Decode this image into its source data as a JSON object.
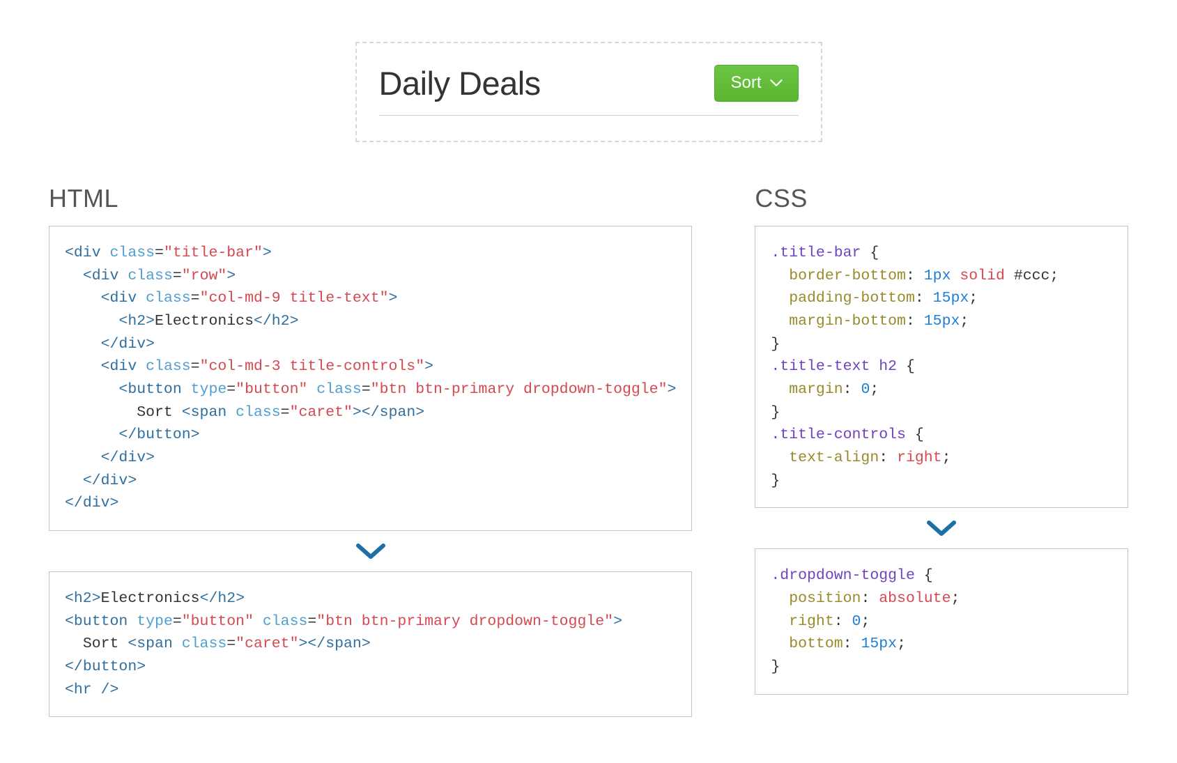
{
  "preview": {
    "title": "Daily Deals",
    "sort_button_label": "Sort"
  },
  "left": {
    "heading": "HTML",
    "code_top_html": "<span class=\"c-punc\">&lt;</span><span class=\"c-tag\">div</span> <span class=\"c-attr\">class</span>=<span class=\"c-str\">\"title-bar\"</span><span class=\"c-punc\">&gt;</span>\n  <span class=\"c-punc\">&lt;</span><span class=\"c-tag\">div</span> <span class=\"c-attr\">class</span>=<span class=\"c-str\">\"row\"</span><span class=\"c-punc\">&gt;</span>\n    <span class=\"c-punc\">&lt;</span><span class=\"c-tag\">div</span> <span class=\"c-attr\">class</span>=<span class=\"c-str\">\"col-md-9 title-text\"</span><span class=\"c-punc\">&gt;</span>\n      <span class=\"c-punc\">&lt;</span><span class=\"c-tag\">h2</span><span class=\"c-punc\">&gt;</span><span class=\"c-text\">Electronics</span><span class=\"c-punc\">&lt;/</span><span class=\"c-tag\">h2</span><span class=\"c-punc\">&gt;</span>\n    <span class=\"c-punc\">&lt;/</span><span class=\"c-tag\">div</span><span class=\"c-punc\">&gt;</span>\n    <span class=\"c-punc\">&lt;</span><span class=\"c-tag\">div</span> <span class=\"c-attr\">class</span>=<span class=\"c-str\">\"col-md-3 title-controls\"</span><span class=\"c-punc\">&gt;</span>\n      <span class=\"c-punc\">&lt;</span><span class=\"c-tag\">button</span> <span class=\"c-attr\">type</span>=<span class=\"c-str\">\"button\"</span> <span class=\"c-attr\">class</span>=<span class=\"c-str\">\"btn btn-primary dropdown-toggle\"</span><span class=\"c-punc\">&gt;</span>\n        <span class=\"c-text\">Sort </span><span class=\"c-punc\">&lt;</span><span class=\"c-tag\">span</span> <span class=\"c-attr\">class</span>=<span class=\"c-str\">\"caret\"</span><span class=\"c-punc\">&gt;&lt;/</span><span class=\"c-tag\">span</span><span class=\"c-punc\">&gt;</span>\n      <span class=\"c-punc\">&lt;/</span><span class=\"c-tag\">button</span><span class=\"c-punc\">&gt;</span>\n    <span class=\"c-punc\">&lt;/</span><span class=\"c-tag\">div</span><span class=\"c-punc\">&gt;</span>\n  <span class=\"c-punc\">&lt;/</span><span class=\"c-tag\">div</span><span class=\"c-punc\">&gt;</span>\n<span class=\"c-punc\">&lt;/</span><span class=\"c-tag\">div</span><span class=\"c-punc\">&gt;</span>",
    "code_bottom_html": "<span class=\"c-punc\">&lt;</span><span class=\"c-tag\">h2</span><span class=\"c-punc\">&gt;</span><span class=\"c-text\">Electronics</span><span class=\"c-punc\">&lt;/</span><span class=\"c-tag\">h2</span><span class=\"c-punc\">&gt;</span>\n<span class=\"c-punc\">&lt;</span><span class=\"c-tag\">button</span> <span class=\"c-attr\">type</span>=<span class=\"c-str\">\"button\"</span> <span class=\"c-attr\">class</span>=<span class=\"c-str\">\"btn btn-primary dropdown-toggle\"</span><span class=\"c-punc\">&gt;</span>\n  <span class=\"c-text\">Sort </span><span class=\"c-punc\">&lt;</span><span class=\"c-tag\">span</span> <span class=\"c-attr\">class</span>=<span class=\"c-str\">\"caret\"</span><span class=\"c-punc\">&gt;&lt;/</span><span class=\"c-tag\">span</span><span class=\"c-punc\">&gt;</span>\n<span class=\"c-punc\">&lt;/</span><span class=\"c-tag\">button</span><span class=\"c-punc\">&gt;</span>\n<span class=\"c-punc\">&lt;</span><span class=\"c-tag\">hr</span> <span class=\"c-punc\">/&gt;</span>"
  },
  "right": {
    "heading": "CSS",
    "code_top_html": "<span class=\"c-sel\">.title-bar</span> <span class=\"c-brace\">{</span>\n  <span class=\"c-prop\">border-bottom</span>: <span class=\"c-num\">1px</span> <span class=\"c-unit\">solid</span> <span class=\"c-hex\">#ccc</span><span class=\"c-semi\">;</span>\n  <span class=\"c-prop\">padding-bottom</span>: <span class=\"c-num\">15px</span><span class=\"c-semi\">;</span>\n  <span class=\"c-prop\">margin-bottom</span>: <span class=\"c-num\">15px</span><span class=\"c-semi\">;</span>\n<span class=\"c-brace\">}</span>\n<span class=\"c-sel\">.title-text h2</span> <span class=\"c-brace\">{</span>\n  <span class=\"c-prop\">margin</span>: <span class=\"c-num\">0</span><span class=\"c-semi\">;</span>\n<span class=\"c-brace\">}</span>\n<span class=\"c-sel\">.title-controls</span> <span class=\"c-brace\">{</span>\n  <span class=\"c-prop\">text-align</span>: <span class=\"c-unit\">right</span><span class=\"c-semi\">;</span>\n<span class=\"c-brace\">}</span>",
    "code_bottom_html": "<span class=\"c-sel\">.dropdown-toggle</span> <span class=\"c-brace\">{</span>\n  <span class=\"c-prop\">position</span>: <span class=\"c-unit\">absolute</span><span class=\"c-semi\">;</span>\n  <span class=\"c-prop\">right</span>: <span class=\"c-num\">0</span><span class=\"c-semi\">;</span>\n  <span class=\"c-prop\">bottom</span>: <span class=\"c-num\">15px</span><span class=\"c-semi\">;</span>\n<span class=\"c-brace\">}</span>"
  },
  "colors": {
    "arrow_blue": "#1d6fa5",
    "button_green": "#5cb531"
  }
}
